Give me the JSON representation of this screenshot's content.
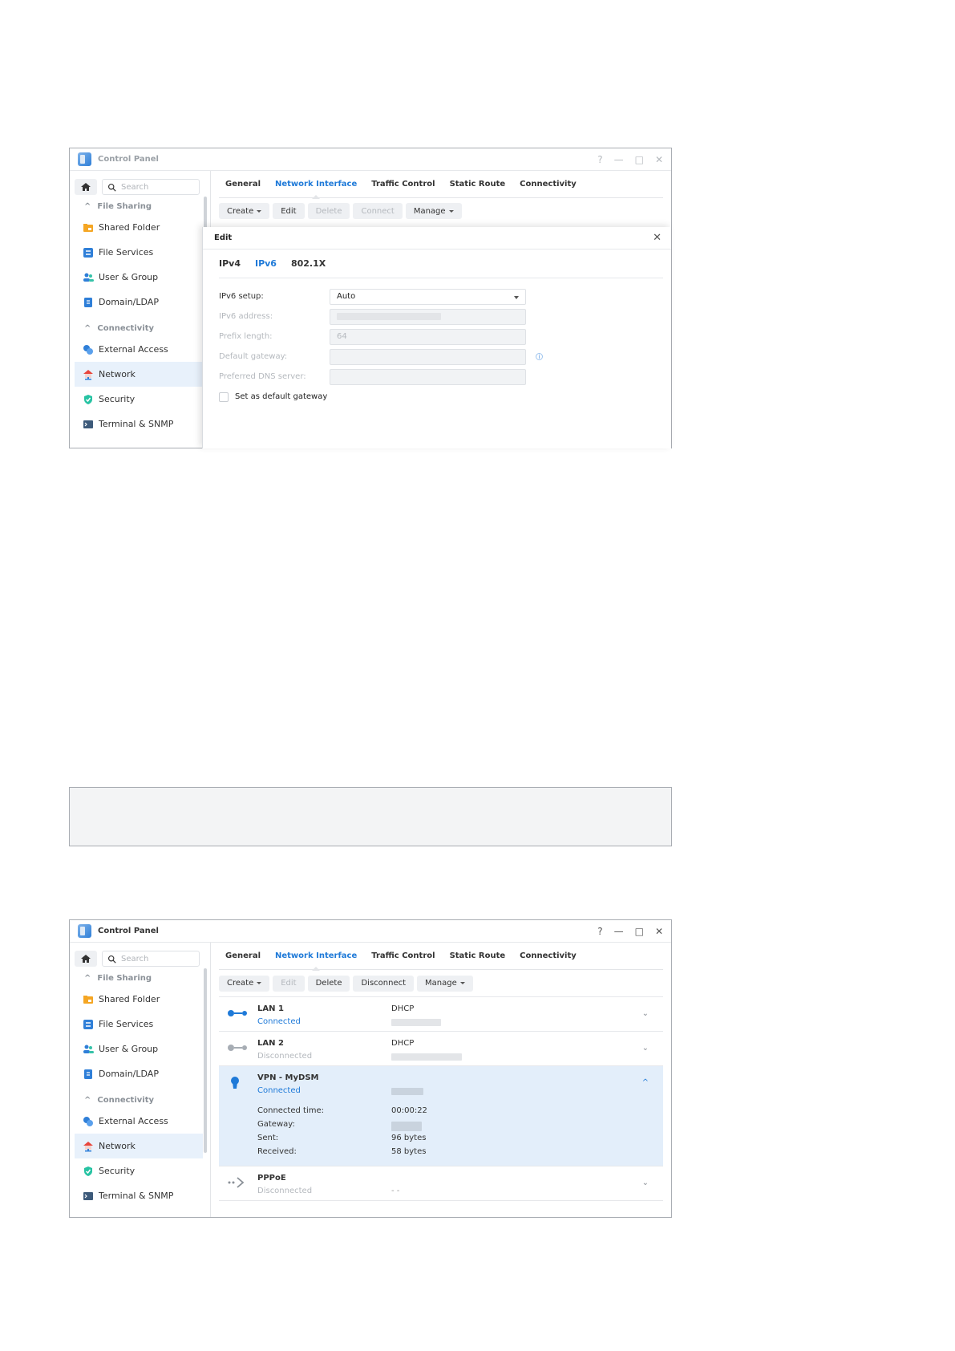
{
  "window1": {
    "title": "Control Panel",
    "help": "?",
    "minimize": "—",
    "maximize": "□",
    "close": "✕"
  },
  "window2": {
    "title": "Control Panel",
    "help": "?",
    "minimize": "—",
    "maximize": "□",
    "close": "✕"
  },
  "sidebar": {
    "search_placeholder": "Search",
    "section_file_sharing": "File Sharing",
    "section_connectivity": "Connectivity",
    "items": {
      "shared_folder": "Shared Folder",
      "file_services": "File Services",
      "user_group": "User & Group",
      "domain_ldap": "Domain/LDAP",
      "external_access": "External Access",
      "network": "Network",
      "security": "Security",
      "terminal_snmp": "Terminal & SNMP"
    }
  },
  "tabs": {
    "general": "General",
    "network_interface": "Network Interface",
    "traffic_control": "Traffic Control",
    "static_route": "Static Route",
    "connectivity": "Connectivity"
  },
  "toolbar": {
    "create": "Create",
    "edit": "Edit",
    "delete": "Delete",
    "connect": "Connect",
    "disconnect": "Disconnect",
    "manage": "Manage"
  },
  "dialog": {
    "title": "Edit",
    "close": "✕",
    "tab_ipv4": "IPv4",
    "tab_ipv6": "IPv6",
    "tab_8021x": "802.1X",
    "ipv6_setup_label": "IPv6 setup:",
    "ipv6_setup_value": "Auto",
    "ipv6_address_label": "IPv6 address:",
    "prefix_length_label": "Prefix length:",
    "prefix_length_value": "64",
    "default_gateway_label": "Default gateway:",
    "preferred_dns_label": "Preferred DNS server:",
    "set_default_gateway": "Set as default gateway",
    "info_icon": "i"
  },
  "list": {
    "lan1": {
      "name": "LAN 1",
      "status": "Connected",
      "protocol": "DHCP"
    },
    "lan2": {
      "name": "LAN 2",
      "status": "Disconnected",
      "protocol": "DHCP"
    },
    "vpn": {
      "name": "VPN - MyDSM",
      "status": "Connected",
      "connected_time_label": "Connected time:",
      "connected_time_value": "00:00:22",
      "gateway_label": "Gateway:",
      "sent_label": "Sent:",
      "sent_value": "96 bytes",
      "received_label": "Received:",
      "received_value": "58 bytes"
    },
    "pppoe": {
      "name": "PPPoE",
      "status": "Disconnected",
      "value": "- -"
    },
    "chevron_down": "⌄",
    "chevron_up": "^"
  },
  "colors": {
    "accent": "#1f7ad8",
    "selected_row": "#e3eefa",
    "sidebar_active": "#e8f1fb"
  }
}
